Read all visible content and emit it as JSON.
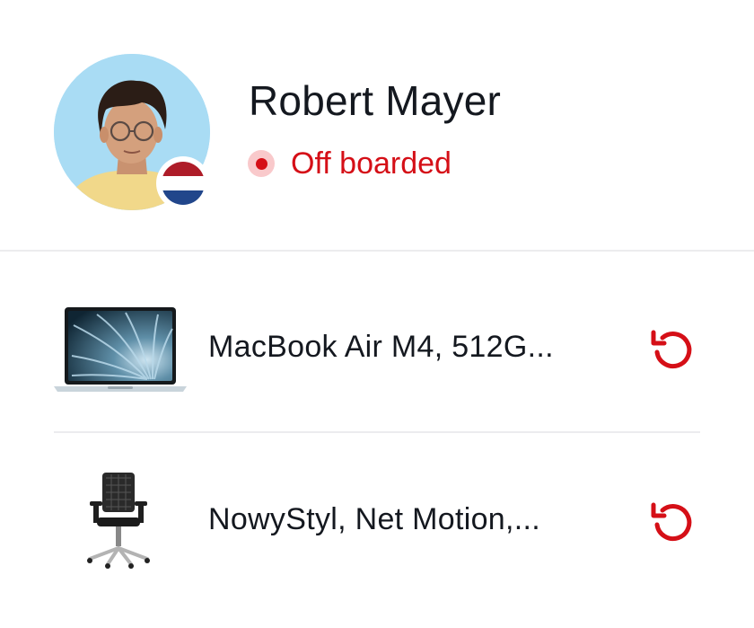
{
  "employee": {
    "name": "Robert Mayer",
    "status": "Off boarded",
    "status_color": "#d50f17",
    "country_flag_icon": "netherlands-flag-icon"
  },
  "assets": [
    {
      "name": "MacBook Air M4, 512G...",
      "icon": "laptop-image",
      "action_icon": "return-icon"
    },
    {
      "name": "NowyStyl, Net Motion,...",
      "icon": "office-chair-image",
      "action_icon": "return-icon"
    }
  ],
  "colors": {
    "accent_red": "#d50f17",
    "status_dot_bg": "#f9c9cb",
    "avatar_bg": "#a9dcf4",
    "divider": "#ececee",
    "text": "#14181f"
  }
}
